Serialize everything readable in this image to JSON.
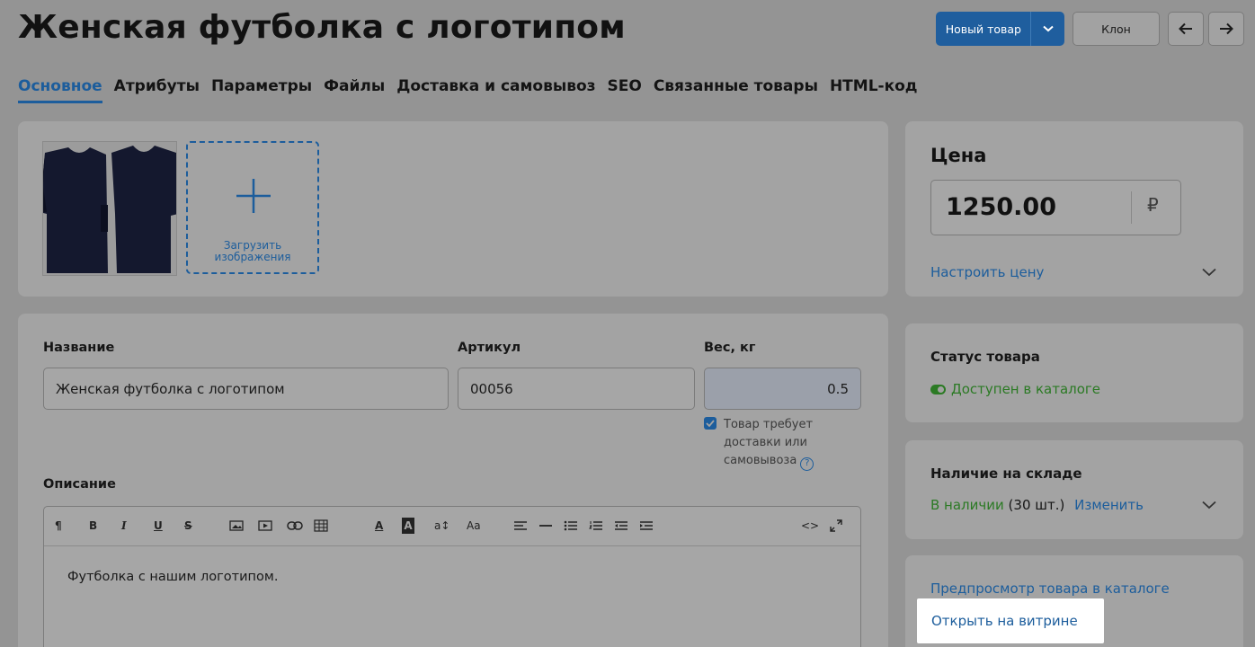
{
  "page": {
    "title": "Женская футболка с логотипом"
  },
  "actions": {
    "new_item_label": "Новый товар",
    "clone_label": "Клон",
    "prev_icon": "arrow-left-icon",
    "next_icon": "arrow-right-icon",
    "dropdown_icon": "chevron-down-icon"
  },
  "tabs": [
    {
      "label": "Основное",
      "active": true
    },
    {
      "label": "Атрибуты",
      "active": false
    },
    {
      "label": "Параметры",
      "active": false
    },
    {
      "label": "Файлы",
      "active": false
    },
    {
      "label": "Доставка и самовывоз",
      "active": false
    },
    {
      "label": "SEO",
      "active": false
    },
    {
      "label": "Связанные товары",
      "active": false
    },
    {
      "label": "HTML-код",
      "active": false
    }
  ],
  "images": {
    "upload_label": "Загрузить\nизображения",
    "thumbnail_icon": "tshirt-image"
  },
  "form": {
    "name_label": "Название",
    "name_value": "Женская футболка с логотипом",
    "sku_label": "Артикул",
    "sku_value": "00056",
    "weight_label": "Вес, кг",
    "weight_value": "0.5",
    "shipping_checkbox_label": "Товар требует\nдоставки или\nсамовывоза",
    "shipping_checked": true,
    "help_icon": "?",
    "description_label": "Описание",
    "description_text": "Футболка с нашим логотипом."
  },
  "editor_toolbar": [
    "paragraph-icon",
    "bold-icon",
    "italic-icon",
    "underline-icon",
    "strikethrough-icon",
    "image-icon",
    "video-icon",
    "link-icon",
    "table-icon",
    "text-color-icon",
    "background-color-icon",
    "font-size-icon",
    "font-family-icon",
    "align-icon",
    "horizontal-rule-icon",
    "bullet-list-icon",
    "numbered-list-icon",
    "outdent-icon",
    "indent-icon",
    "code-view-icon",
    "fullscreen-icon"
  ],
  "price": {
    "heading": "Цена",
    "value": "1250.00",
    "currency": "₽",
    "configure_link": "Настроить цену"
  },
  "status": {
    "heading": "Статус товара",
    "value": "Доступен в каталоге"
  },
  "stock": {
    "heading": "Наличие на складе",
    "availability": "В наличии",
    "count": "(30 шт.)",
    "change_link": "Изменить"
  },
  "links": {
    "preview": "Предпросмотр товара в каталоге",
    "open_storefront": "Открыть на витрине"
  },
  "colors": {
    "accent": "#1c5d9c",
    "success": "#2b7a24",
    "overlay": "#949494"
  }
}
